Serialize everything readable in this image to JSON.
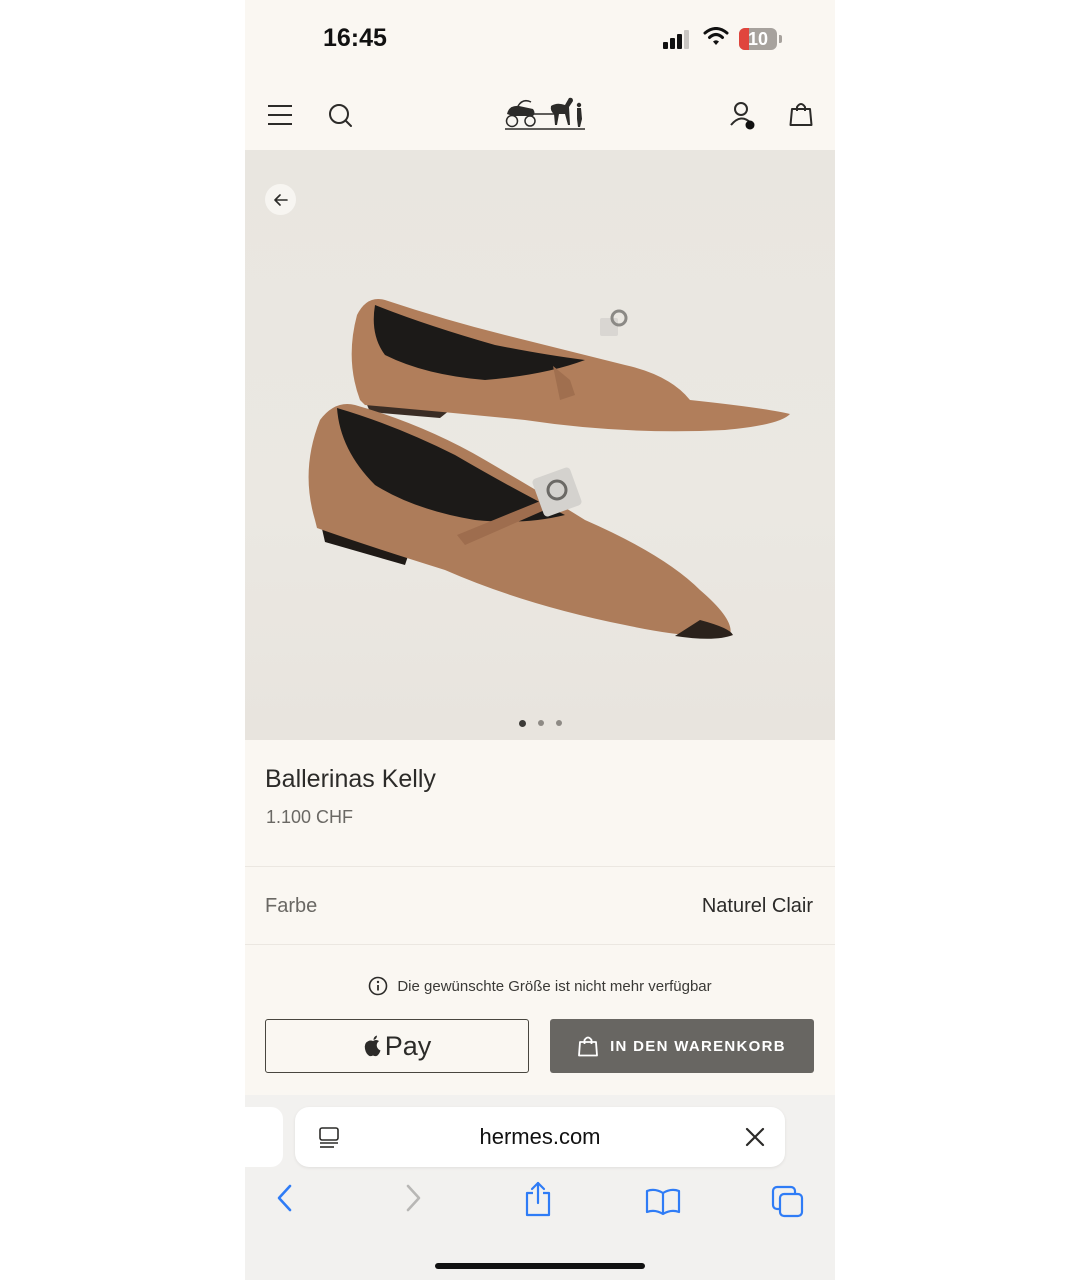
{
  "status": {
    "time": "16:45",
    "battery": "10"
  },
  "product": {
    "title": "Ballerinas Kelly",
    "price": "1.100 CHF",
    "color_label": "Farbe",
    "color_value": "Naturel Clair",
    "availability": "Die gewünschte Größe ist nicht mehr verfügbar"
  },
  "gallery": {
    "pages": 3,
    "active": 1
  },
  "actions": {
    "applepay_label": "Pay",
    "cart_label": "IN DEN WARENKORB"
  },
  "browser": {
    "url": "hermes.com"
  },
  "colors": {
    "background": "#faf7f2",
    "cart_button": "#686662",
    "safari_blue": "#2f7cf6"
  },
  "icons": [
    "menu-icon",
    "search-icon",
    "hermes-logo",
    "account-icon",
    "shopping-bag-icon",
    "back-arrow-icon",
    "info-icon",
    "apple-icon",
    "reader-icon",
    "close-icon",
    "back-icon",
    "forward-icon",
    "share-icon",
    "bookmarks-icon",
    "tabs-icon"
  ]
}
